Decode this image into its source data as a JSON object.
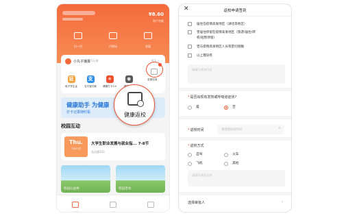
{
  "left_app": {
    "balance": "¥8.60",
    "balance_label": "账户余额",
    "quick_actions": [
      {
        "label": "扫一扫",
        "icon": "scan-icon"
      },
      {
        "label": "付款码",
        "icon": "qr-code-icon"
      },
      {
        "label": "充值",
        "icon": "wallet-icon"
      }
    ],
    "card": {
      "title": "小丸子播报",
      "subtitle": "5天前",
      "more": "更多 >"
    },
    "services": [
      {
        "label": "电子学生证",
        "icon": "student-card-icon",
        "color": "#f4a23c",
        "glyph": "证"
      },
      {
        "label": "支付宝付款",
        "icon": "alipay-icon",
        "color": "#2b8fe8",
        "glyph": "支"
      },
      {
        "label": "健康打卡3.0",
        "icon": "health-checkin-icon",
        "color": "#f0502d",
        "glyph": "+"
      },
      {
        "label": "蜂疆影像",
        "icon": "camera-icon",
        "color": "#555",
        "glyph": "◉"
      }
    ],
    "all_apps_label": "全部应用",
    "banner": {
      "line1": "健康助手 为健康",
      "line2": "打卡记录随时看"
    },
    "magnifier_label": "健康返校",
    "section_title": "校园互动",
    "course": {
      "day": "Thu.",
      "day_sub": "7月12日",
      "title": "大学生职业发展与就业指... 7-8节",
      "location": "浩天楼203"
    },
    "tiles": [
      {
        "label": "校园公益林"
      },
      {
        "label": "校园活动"
      }
    ],
    "tabs": [
      {
        "label": "首页",
        "active": true
      },
      {
        "label": "消息"
      },
      {
        "label": "我的"
      }
    ]
  },
  "right_app": {
    "close_label": "✕",
    "title": "返校申请签到",
    "checkboxes": [
      "居住在疫情高发地区（湖北等地区）",
      "曾居住停留在疫情高发地区（旅游/居住/转",
      "机/短暂停留）",
      "曾与疫情高发地区人员有密切接触",
      "以上都没有"
    ],
    "textarea_placeholder": "请填写具体行程",
    "q1": {
      "label": "是否出现有发热或呼吸道症状?",
      "options": [
        {
          "label": "是"
        },
        {
          "label": "否",
          "selected": true
        }
      ]
    },
    "return_time": {
      "label": "返校时间",
      "placeholder": "请选择返校时间"
    },
    "transport": {
      "label": "返校方式",
      "options": [
        {
          "label": "自驾"
        },
        {
          "label": "火车"
        },
        {
          "label": "飞机"
        },
        {
          "label": "其他"
        }
      ]
    },
    "transport_placeholder": "请填写具体信息",
    "approver_label": "选择审批人"
  }
}
